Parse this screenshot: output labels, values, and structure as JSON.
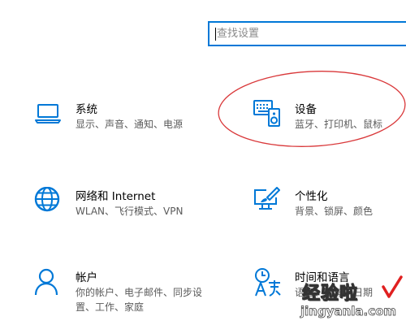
{
  "search": {
    "placeholder": "查找设置",
    "value": ""
  },
  "tiles": [
    {
      "title": "系统",
      "desc": "显示、声音、通知、电源",
      "icon": "laptop-icon"
    },
    {
      "title": "设备",
      "desc": "蓝牙、打印机、鼠标",
      "icon": "keyboard-speaker-icon"
    },
    {
      "title": "网络和 Internet",
      "desc": "WLAN、飞行模式、VPN",
      "icon": "globe-icon"
    },
    {
      "title": "个性化",
      "desc": "背景、锁屏、颜色",
      "icon": "paint-brush-monitor-icon"
    },
    {
      "title": "帐户",
      "desc": "你的帐户、电子邮件、同步设置、工作、家庭",
      "icon": "person-icon"
    },
    {
      "title": "时间和语言",
      "desc": "语音、区域、日期",
      "icon": "time-language-icon"
    }
  ],
  "annotation": {
    "color": "#d9383a"
  },
  "watermark": {
    "text": "经验啦",
    "url": "jingyanla.com"
  },
  "colors": {
    "accent": "#0078d7",
    "title": "#000000",
    "desc": "#5a5a5a"
  }
}
